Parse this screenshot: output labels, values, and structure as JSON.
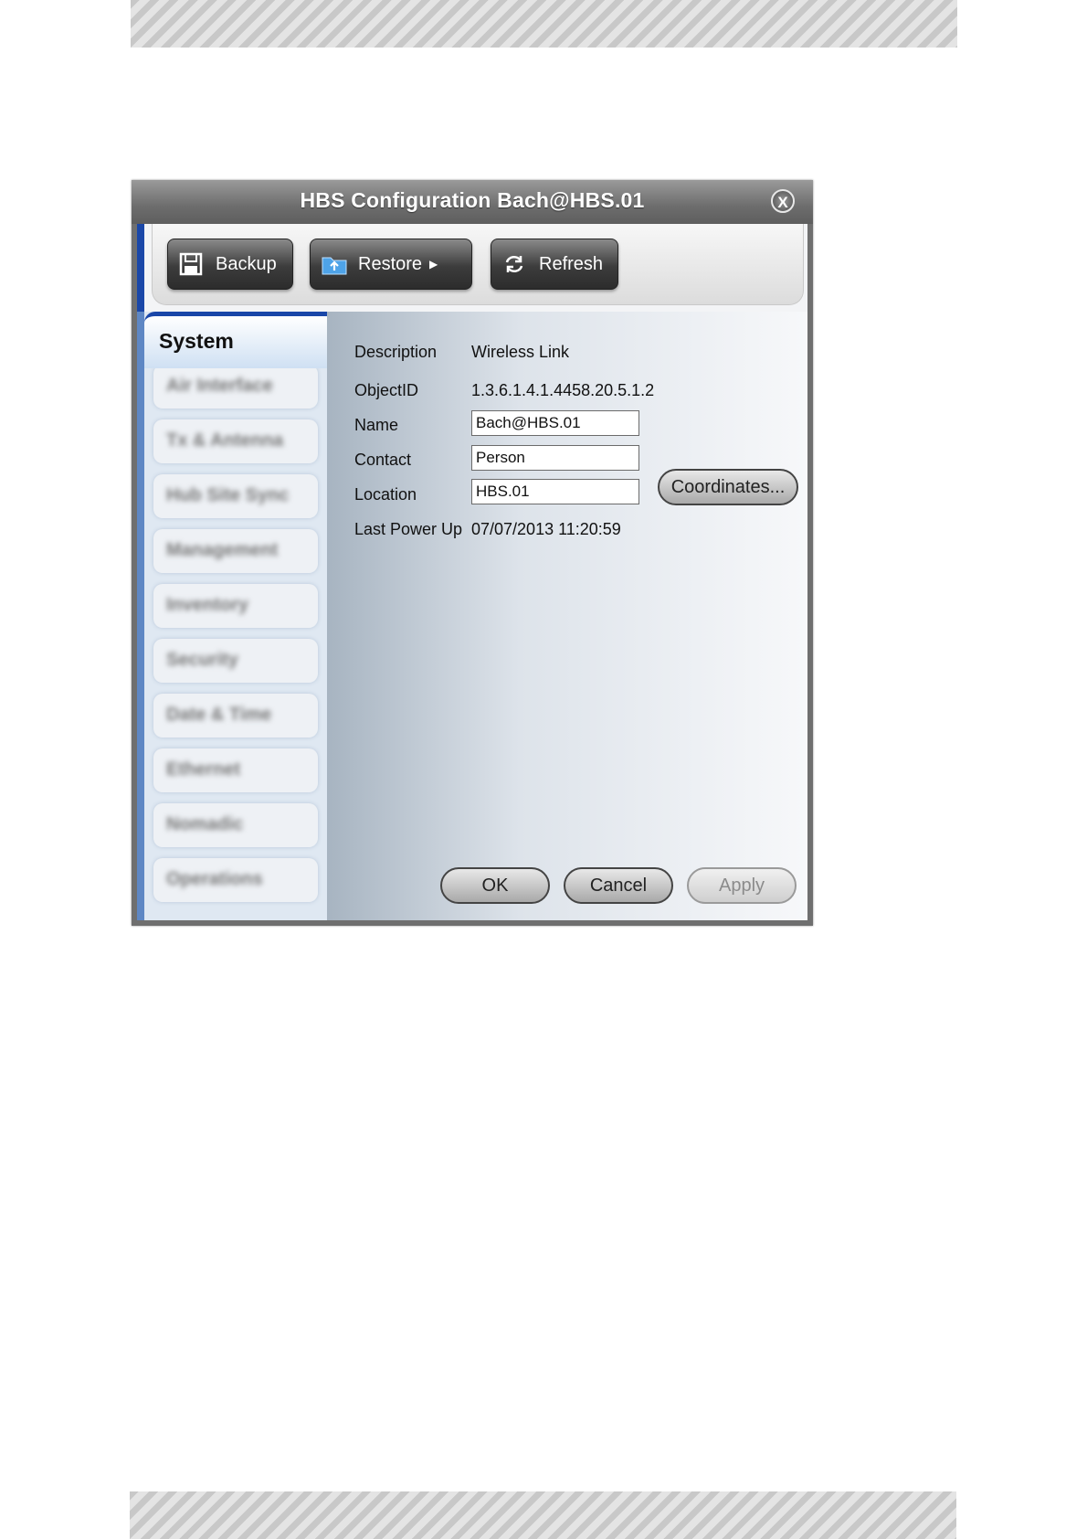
{
  "window": {
    "title": "HBS Configuration Bach@HBS.01",
    "close_label": "X"
  },
  "toolbar": {
    "backup_label": "Backup",
    "restore_label": "Restore",
    "refresh_label": "Refresh",
    "icons": [
      "save-icon",
      "folder-restore-icon",
      "refresh-icon"
    ]
  },
  "sidebar": {
    "selected": "System",
    "items": [
      "Air Interface",
      "Tx & Antenna",
      "Hub Site Sync",
      "Management",
      "Inventory",
      "Security",
      "Date & Time",
      "Ethernet",
      "Nomadic",
      "Operations"
    ]
  },
  "system": {
    "description_label": "Description",
    "description_value": "Wireless Link",
    "objectid_label": "ObjectID",
    "objectid_value": "1.3.6.1.4.1.4458.20.5.1.2",
    "name_label": "Name",
    "name_value": "Bach@HBS.01",
    "contact_label": "Contact",
    "contact_value": "Person",
    "location_label": "Location",
    "location_value": "HBS.01",
    "coordinates_label": "Coordinates...",
    "lastpower_label": "Last Power Up",
    "lastpower_value": "07/07/2013 11:20:59"
  },
  "footer": {
    "ok_label": "OK",
    "cancel_label": "Cancel",
    "apply_label": "Apply"
  }
}
